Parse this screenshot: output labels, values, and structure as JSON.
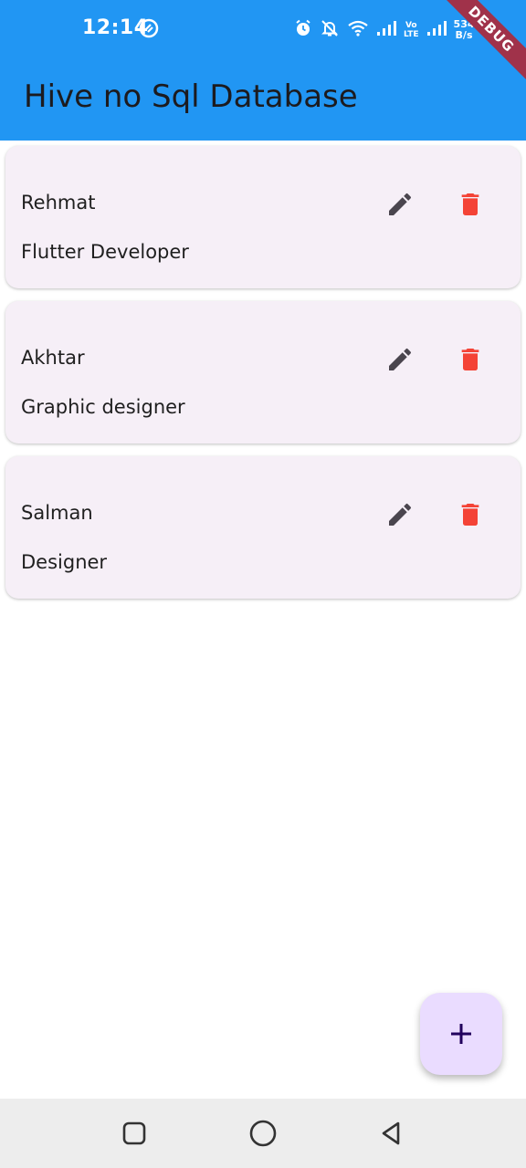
{
  "status_bar": {
    "time": "12:14",
    "net_speed_value": "534",
    "net_speed_unit": "B/s",
    "lte_top": "Vo",
    "lte_bottom": "LTE"
  },
  "debug_banner": "DEBUG",
  "app_bar": {
    "title": "Hive no Sql Database"
  },
  "colors": {
    "app_bar": "#2196f3",
    "card": "#f6eff7",
    "edit_icon": "#4a454e",
    "delete_icon": "#f44336",
    "fab": "#eadcff"
  },
  "items": [
    {
      "name": "Rehmat",
      "role": "Flutter Developer"
    },
    {
      "name": "Akhtar",
      "role": "Graphic designer"
    },
    {
      "name": "Salman",
      "role": "Designer"
    }
  ],
  "icons": {
    "edit": "pencil-icon",
    "delete": "trash-icon",
    "fab": "plus-icon",
    "nav": [
      "square-recents-icon",
      "circle-home-icon",
      "triangle-back-icon"
    ]
  }
}
